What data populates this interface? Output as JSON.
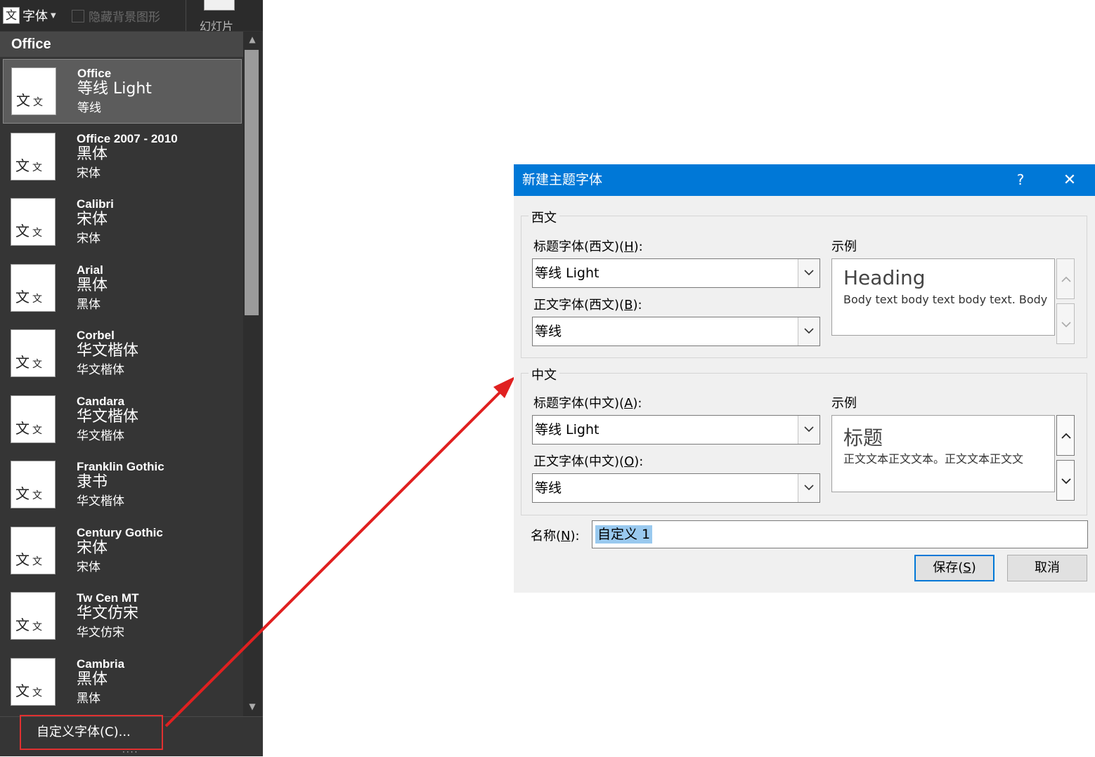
{
  "toolbar": {
    "font_button_icon": "文",
    "font_button_label": "字体",
    "hide_background_label": "隐藏背景图形",
    "slide_label": "幻灯片"
  },
  "font_panel": {
    "section_header": "Office",
    "items": [
      {
        "name": "Office",
        "heading_font": "等线 Light",
        "body_font": "等线",
        "selected": true
      },
      {
        "name": "Office 2007 - 2010",
        "heading_font": "黑体",
        "body_font": "宋体"
      },
      {
        "name": "Calibri",
        "heading_font": "宋体",
        "body_font": "宋体"
      },
      {
        "name": "Arial",
        "heading_font": "黑体",
        "body_font": "黑体"
      },
      {
        "name": "Corbel",
        "heading_font": "华文楷体",
        "body_font": "华文楷体"
      },
      {
        "name": "Candara",
        "heading_font": "华文楷体",
        "body_font": "华文楷体"
      },
      {
        "name": "Franklin Gothic",
        "heading_font": "隶书",
        "body_font": "华文楷体"
      },
      {
        "name": "Century Gothic",
        "heading_font": "宋体",
        "body_font": "宋体"
      },
      {
        "name": "Tw Cen MT",
        "heading_font": "华文仿宋",
        "body_font": "华文仿宋"
      },
      {
        "name": "Cambria",
        "heading_font": "黑体",
        "body_font": "黑体"
      }
    ],
    "thumb_text_a": "文",
    "thumb_text_b": "文",
    "customize_label": "自定义字体(C)...",
    "scroll_up_icon": "triangle-up",
    "scroll_down_icon": "triangle-down"
  },
  "dialog": {
    "title": "新建主题字体",
    "help_label": "?",
    "close_label": "✕",
    "western": {
      "group_label": "西文",
      "heading_label_pre": "标题字体(西文)(",
      "heading_label_key": "H",
      "heading_label_post": "):",
      "heading_value": "等线 Light",
      "body_label_pre": "正文字体(西文)(",
      "body_label_key": "B",
      "body_label_post": "):",
      "body_value": "等线",
      "sample_label": "示例",
      "sample_heading": "Heading",
      "sample_body": "Body text body text body text. Body"
    },
    "chinese": {
      "group_label": "中文",
      "heading_label_pre": "标题字体(中文)(",
      "heading_label_key": "A",
      "heading_label_post": "):",
      "heading_value": "等线 Light",
      "body_label_pre": "正文字体(中文)(",
      "body_label_key": "O",
      "body_label_post": "):",
      "body_value": "等线",
      "sample_label": "示例",
      "sample_heading": "标题",
      "sample_body": "正文文本正文文本。正文文本正文文"
    },
    "name_label_pre": "名称(",
    "name_label_key": "N",
    "name_label_post": "):",
    "name_value": "自定义 1",
    "save_pre": "保存(",
    "save_key": "S",
    "save_post": ")",
    "cancel_label": "取消"
  },
  "colors": {
    "panel_bg": "#353535",
    "dialog_titlebar": "#0078d7",
    "annotation_red": "#e02020"
  }
}
